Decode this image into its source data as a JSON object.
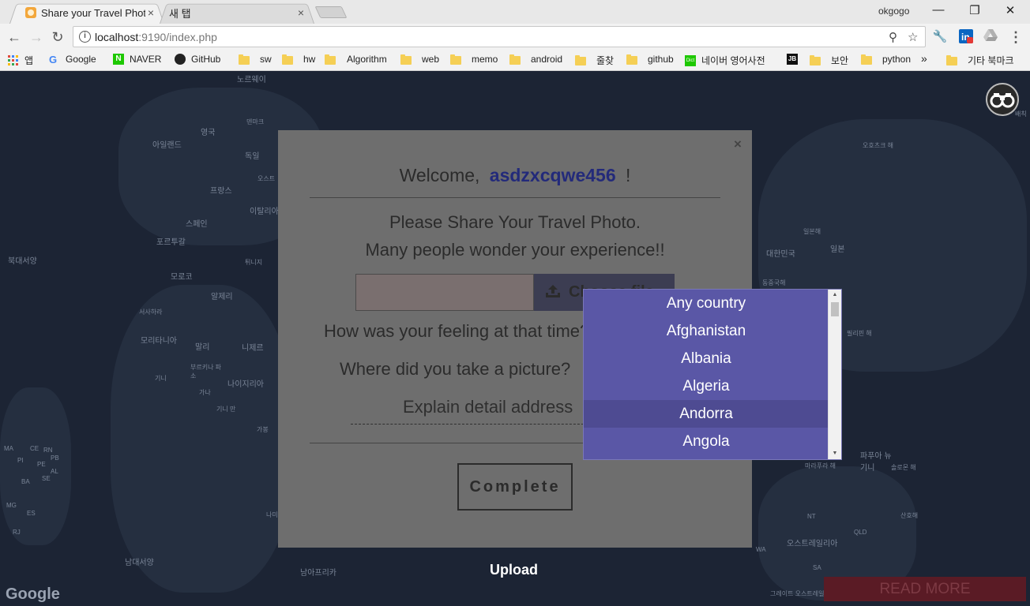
{
  "browser": {
    "tabs": [
      {
        "title": "Share your Travel Photo",
        "close": "×"
      },
      {
        "title": "새 탭",
        "close": "×"
      }
    ],
    "profile": "okgogo",
    "window_controls": {
      "minimize": "—",
      "restore": "❐",
      "close": "✕"
    },
    "url_host": "localhost",
    "url_rest": ":9190/index.php",
    "bookmarks": [
      {
        "label": "앱",
        "icon": "apps-grid-icon"
      },
      {
        "label": "Google",
        "icon": "google-icon"
      },
      {
        "label": "NAVER",
        "icon": "naver-icon"
      },
      {
        "label": "GitHub",
        "icon": "github-icon"
      },
      {
        "label": "sw",
        "icon": "folder-icon"
      },
      {
        "label": "hw",
        "icon": "folder-icon"
      },
      {
        "label": "Algorithm",
        "icon": "folder-icon"
      },
      {
        "label": "web",
        "icon": "folder-icon"
      },
      {
        "label": "memo",
        "icon": "folder-icon"
      },
      {
        "label": "android",
        "icon": "folder-icon"
      },
      {
        "label": "줄찾",
        "icon": "folder-icon"
      },
      {
        "label": "github",
        "icon": "folder-icon"
      },
      {
        "label": "네이버 영어사전",
        "icon": "dict-icon"
      },
      {
        "label": "",
        "icon": "jb-icon"
      },
      {
        "label": "보안",
        "icon": "folder-icon"
      },
      {
        "label": "python",
        "icon": "folder-icon"
      }
    ],
    "bookmarks_overflow": "»",
    "other_bookmarks": "기타 북마크"
  },
  "map": {
    "labels": [
      "노르웨이",
      "영국",
      "덴마크",
      "아일랜드",
      "독일",
      "오스트",
      "프랑스",
      "이탈리아",
      "스페인",
      "포르투갈",
      "북대서양",
      "튀니지",
      "모로코",
      "알제리",
      "서사하라",
      "모리타니아",
      "말리",
      "니제르",
      "부르키나 파소",
      "나이지리아",
      "기니",
      "가나",
      "기니 만",
      "가봉",
      "남대서양",
      "나미",
      "남아프리카",
      "오호츠크 해",
      "일본해",
      "일본",
      "대한민국",
      "동중국해",
      "필리핀 해",
      "파푸아 뉴기니",
      "솔로몬 해",
      "산호해",
      "오스트레일리아",
      "마라푸라 해",
      "그레이트 오스트레일리아",
      "NT",
      "QLD",
      "WA",
      "SA",
      "MA",
      "CE",
      "RN",
      "PB",
      "PI",
      "PE",
      "AL",
      "BA",
      "SE",
      "MG",
      "ES",
      "RJ",
      "배칙"
    ],
    "google": "Google"
  },
  "modal": {
    "close": "×",
    "welcome_prefix": "Welcome,",
    "username": "asdzxcqwe456",
    "welcome_suffix": "!",
    "line1": "Please Share Your Travel Photo.",
    "line2": "Many people wonder your experience!!",
    "choose_file": "Choose file",
    "question_feeling": "How was your feeling at that time?",
    "question_where": "Where did you take a picture?",
    "address_placeholder": "Explain detail address",
    "complete": "Complete"
  },
  "country_dropdown": {
    "options": [
      "Any country",
      "Afghanistan",
      "Albania",
      "Algeria",
      "Andorra",
      "Angola"
    ],
    "hovered": "Andorra"
  },
  "upload_label": "Upload",
  "read_more": "READ MORE",
  "colors": {
    "modal_bg": "#6e6e6e",
    "dropdown_bg": "#5a57a6",
    "username": "#232a7a",
    "read_more_bg": "#5a1b25"
  }
}
